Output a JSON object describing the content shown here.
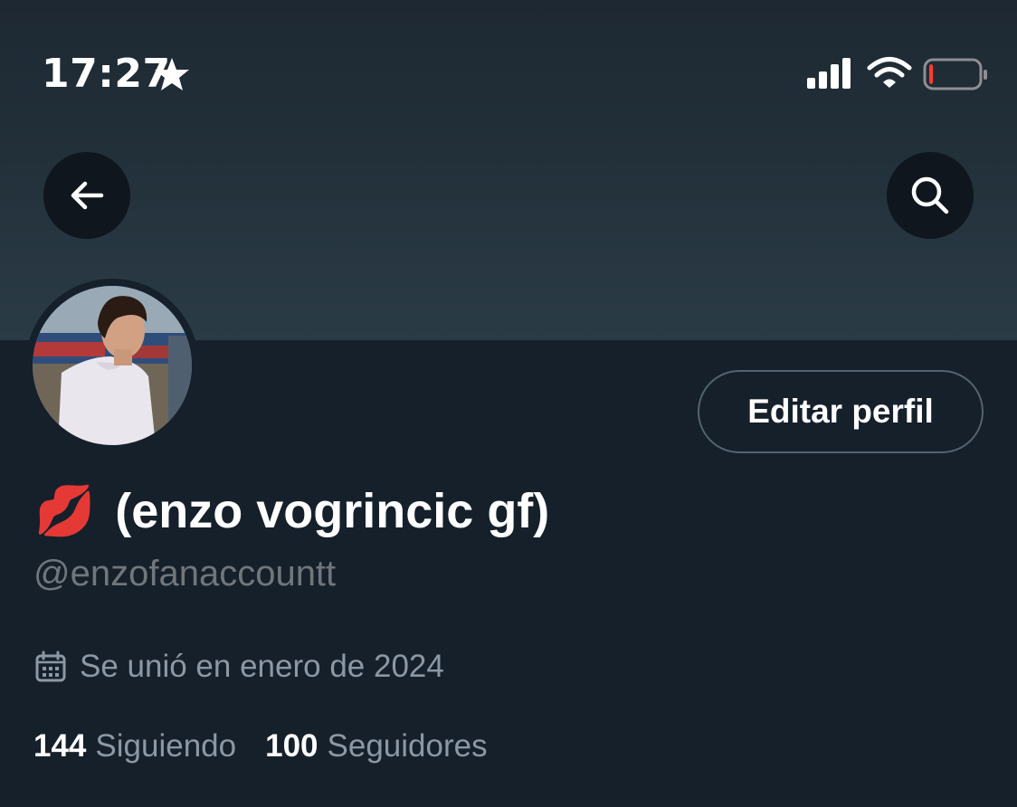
{
  "status_bar": {
    "time": "17:27",
    "icons": [
      "star-icon",
      "signal-icon",
      "wifi-icon",
      "battery-icon"
    ],
    "battery_level": 0.08
  },
  "header": {
    "back_icon": "arrow-left-icon",
    "search_icon": "search-icon"
  },
  "profile": {
    "display_name_emoji": "💋",
    "display_name": "(enzo vogrincic gf)",
    "handle": "@enzofanaccountt",
    "joined": "Se unió en enero de 2024",
    "edit_button_label": "Editar perfil",
    "following_count": "144",
    "following_label": "Siguiendo",
    "followers_count": "100",
    "followers_label": "Seguidores"
  },
  "colors": {
    "background": "#15202b",
    "button_bg": "#0f161d",
    "secondary_text": "#71767b",
    "border": "#536471",
    "battery_low": "#ff3b30"
  }
}
